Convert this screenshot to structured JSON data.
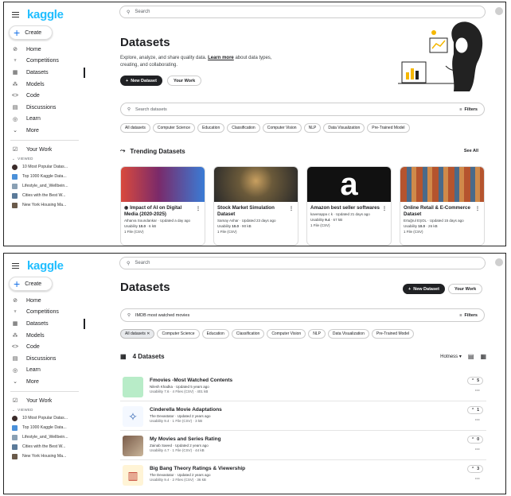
{
  "brand": {
    "logo": "kaggle"
  },
  "sidebar": {
    "create_label": "Create",
    "items": [
      {
        "label": "Home",
        "icon": "home-icon"
      },
      {
        "label": "Competitions",
        "icon": "trophy-icon"
      },
      {
        "label": "Datasets",
        "icon": "table-icon"
      },
      {
        "label": "Models",
        "icon": "models-icon"
      },
      {
        "label": "Code",
        "icon": "code-icon"
      },
      {
        "label": "Discussions",
        "icon": "discussions-icon"
      },
      {
        "label": "Learn",
        "icon": "learn-icon"
      },
      {
        "label": "More",
        "icon": "chevron-down-icon"
      }
    ],
    "active_item": "Datasets",
    "your_work_label": "Your Work",
    "viewed_label": "VIEWED",
    "recent": [
      {
        "label": "10 Most Popular Datas...",
        "color": "#3b2b2a"
      },
      {
        "label": "Top 1000 Kaggle Data...",
        "color": "#4a90d9"
      },
      {
        "label": "Lifestyle_and_Wellbein...",
        "color": "#8aa0b4"
      },
      {
        "label": "Cities with the Best W...",
        "color": "#5b7a99"
      },
      {
        "label": "New York Housing Ma...",
        "color": "#6a5a4a"
      }
    ]
  },
  "top": {
    "search_placeholder": "Search",
    "title": "Datasets",
    "description": "Explore, analyze, and share quality data.",
    "learn_more": "Learn more",
    "description_tail": "about data types, creating, and collaborating.",
    "new_dataset_label": "New Dataset",
    "your_work_label": "Your Work",
    "filter_placeholder": "Search datasets",
    "filters_label": "Filters",
    "chips": [
      "All datasets",
      "Computer Science",
      "Education",
      "Classification",
      "Computer Vision",
      "NLP",
      "Data Visualization",
      "Pre-Trained Model"
    ],
    "trending_title": "Trending Datasets",
    "see_all": "See All",
    "cards": [
      {
        "title": "Impact of AI on Digital Media (2020-2025)",
        "author": "Atharva Soundankar · Updated a day ago",
        "usability": "Usability",
        "score": "10.0",
        "size": "· 6 kB",
        "files": "1 File (CSV)",
        "colors": [
          "#d94a3d",
          "#3a7bd5"
        ]
      },
      {
        "title": "Stock Market Simulation Dataset",
        "author": "Samay Ashar · Updated 23 days ago",
        "usability": "Usability",
        "score": "10.0",
        "size": "· 90 kB",
        "files": "1 File (CSV)",
        "colors": [
          "#6b5a3a",
          "#2a2a2a"
        ]
      },
      {
        "title": "Amazon best seller softwares",
        "author": "kaverappa c k · Updated 21 days ago",
        "usability": "Usability",
        "score": "9.4",
        "size": "· 67 kB",
        "files": "1 File (CSV)",
        "colors": [
          "#111111",
          "#111111"
        ]
      },
      {
        "title": "Online Retail & E-Commerce Dataset",
        "author": "Ertuğrul EŞOL · Updated 15 days ago",
        "usability": "Usability",
        "score": "10.0",
        "size": "· 26 kB",
        "files": "1 File (CSV)",
        "colors": [
          "#b5542e",
          "#4a6a8a"
        ]
      }
    ]
  },
  "bottom": {
    "search_placeholder": "Search",
    "title": "Datasets",
    "new_dataset_label": "New Dataset",
    "your_work_label": "Your Work",
    "query": "IMDB most watched movies",
    "filters_label": "Filters",
    "chips": [
      "All datasets",
      "Computer Science",
      "Education",
      "Classification",
      "Computer Vision",
      "NLP",
      "Data Visualization",
      "Pre-Trained Model"
    ],
    "count_label": "4 Datasets",
    "sort_label": "Hotness",
    "results": [
      {
        "title": "Fmovies -Most Watched Contents",
        "author": "Nilesh Khadka · Updated 5 years ago",
        "usability": "Usability",
        "score": "7.6",
        "detail": "· 4 Files (CSV) · 401 kB",
        "votes": "5",
        "color": "#b8ecc8"
      },
      {
        "title": "Cinderella Movie Adaptations",
        "author": "The Devastator · Updated 2 years ago",
        "usability": "Usability",
        "score": "9.4",
        "detail": "· 1 File (CSV) · 3 kB",
        "votes": "1",
        "color": "#f4f8ff"
      },
      {
        "title": "My Movies and Series Rating",
        "author": "Zainab Saeed · Updated 2 years ago",
        "usability": "Usability",
        "score": "4.7",
        "detail": "· 1 File (CSV) · 44 kB",
        "votes": "0",
        "color": "#7a5c4a"
      },
      {
        "title": "Big Bang Theory Ratings & Viewership",
        "author": "The Devastator · Updated 2 years ago",
        "usability": "Usability",
        "score": "9.4",
        "detail": "· 2 Files (CSV) · 36 kB",
        "votes": "3",
        "color": "#fff4d6"
      }
    ]
  }
}
